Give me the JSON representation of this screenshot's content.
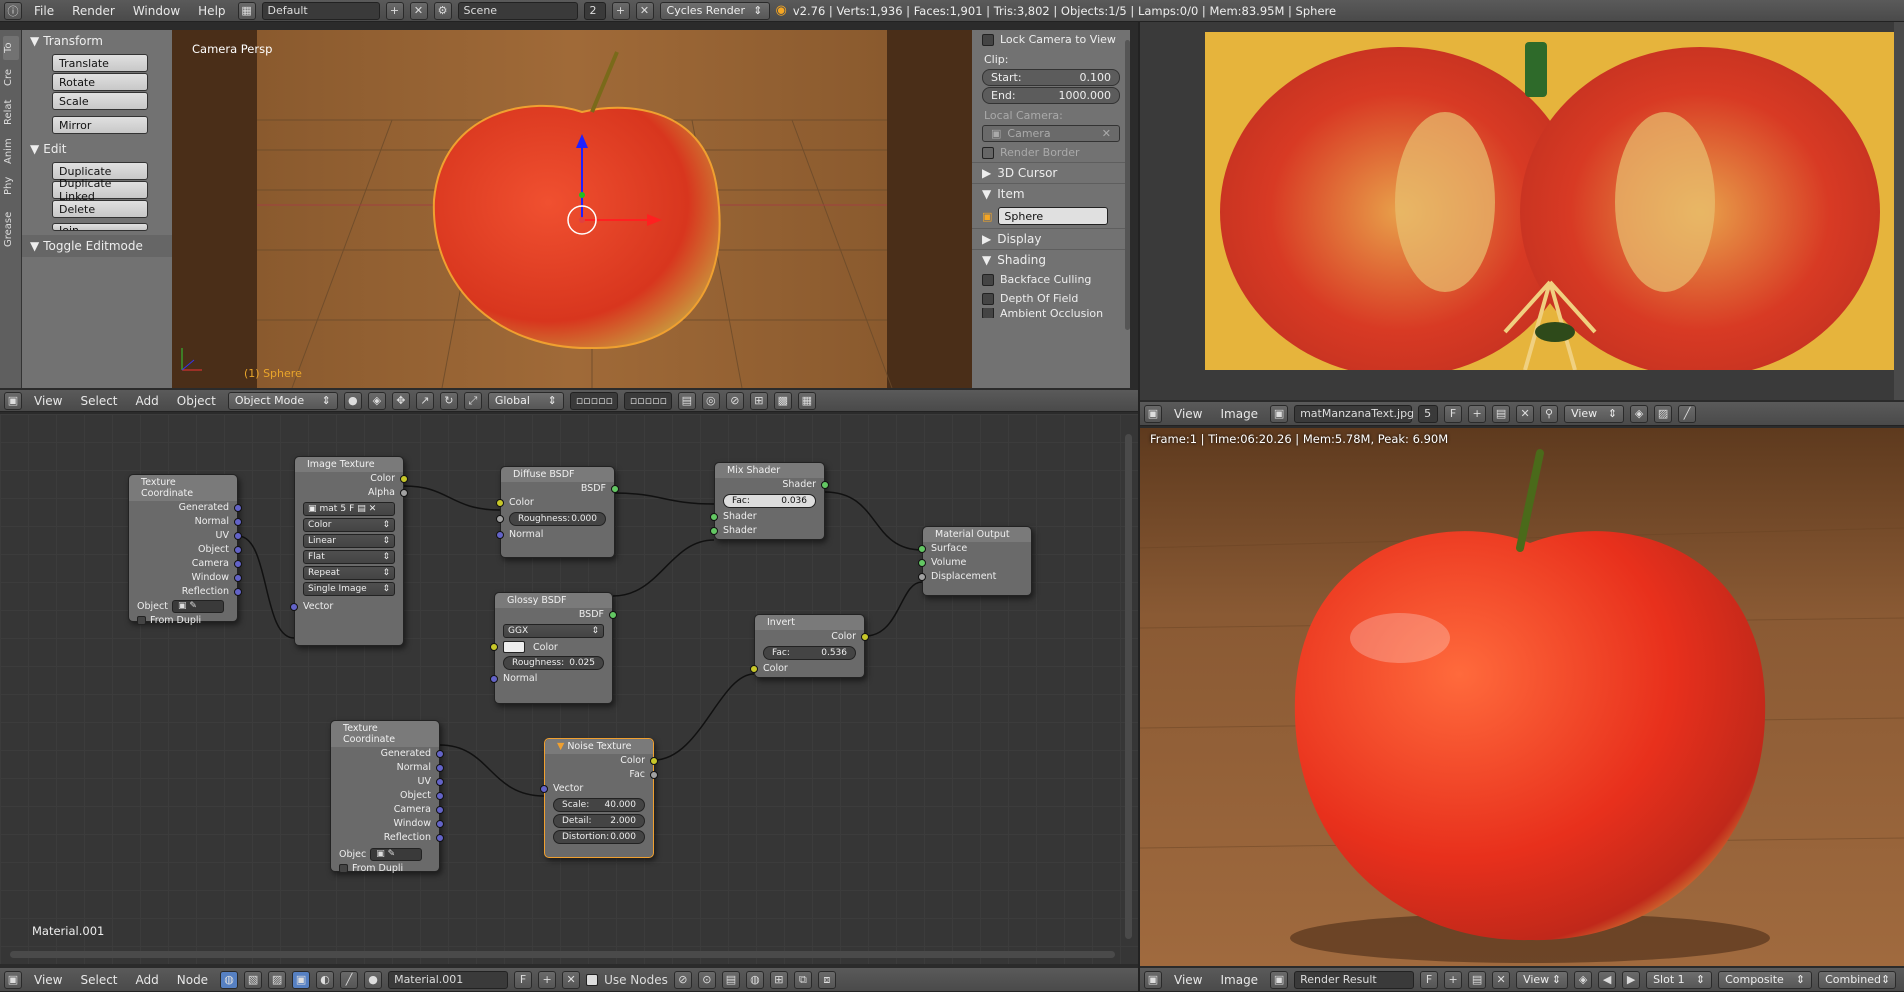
{
  "top_bar": {
    "menus": [
      "File",
      "Render",
      "Window",
      "Help"
    ],
    "layout": "Default",
    "scene": "Scene",
    "scene_users": "2",
    "engine": "Cycles Render",
    "stats": "v2.76 | Verts:1,936 | Faces:1,901 | Tris:3,802 | Objects:1/5 | Lamps:0/0 | Mem:83.95M | Sphere"
  },
  "tool_tabs": [
    "To",
    "Cre",
    "Relat",
    "Anim",
    "Phy",
    "Grease"
  ],
  "tool_panel": {
    "transform": "Transform",
    "translate": "Translate",
    "rotate": "Rotate",
    "scale": "Scale",
    "mirror": "Mirror",
    "edit": "Edit",
    "duplicate": "Duplicate",
    "duplicate_linked": "Duplicate Linked",
    "delete": "Delete",
    "join": "Join",
    "toggle_editmode": "Toggle Editmode"
  },
  "viewport": {
    "label": "Camera Persp",
    "object_label": "(1) Sphere"
  },
  "props_panel": {
    "lock_camera": "Lock Camera to View",
    "clip": "Clip:",
    "start_label": "Start:",
    "start_value": "0.100",
    "end_label": "End:",
    "end_value": "1000.000",
    "local_camera": "Local Camera:",
    "camera": "Camera",
    "render_border": "Render Border",
    "cursor3d": "3D Cursor",
    "item": "Item",
    "item_name": "Sphere",
    "display": "Display",
    "shading": "Shading",
    "backface": "Backface Culling",
    "dof": "Depth Of Field",
    "ao": "Ambient Occlusion"
  },
  "view3d_header": {
    "view": "View",
    "select": "Select",
    "add": "Add",
    "object": "Object",
    "mode": "Object Mode",
    "orientation": "Global"
  },
  "nodes": {
    "texcoord1": {
      "title": "Texture Coordinate",
      "outs": [
        "Generated",
        "Normal",
        "UV",
        "Object",
        "Camera",
        "Window",
        "Reflection"
      ],
      "object": "Object",
      "from_dupli": "From Dupli"
    },
    "image": {
      "title": "Image Texture",
      "outs": [
        "Color",
        "Alpha"
      ],
      "img": "mat",
      "users": "5",
      "f": "F",
      "color": "Color",
      "interp": "Linear",
      "proj": "Flat",
      "ext": "Repeat",
      "src": "Single Image",
      "vector": "Vector"
    },
    "diffuse": {
      "title": "Diffuse BSDF",
      "out": "BSDF",
      "color": "Color",
      "rough_label": "Roughness:",
      "rough": "0.000",
      "normal": "Normal"
    },
    "mix": {
      "title": "Mix Shader",
      "out": "Shader",
      "fac_label": "Fac:",
      "fac": "0.036",
      "s1": "Shader",
      "s2": "Shader"
    },
    "output": {
      "title": "Material Output",
      "surface": "Surface",
      "volume": "Volume",
      "displacement": "Displacement"
    },
    "glossy": {
      "title": "Glossy BSDF",
      "out": "BSDF",
      "dist": "GGX",
      "color": "Color",
      "rough_label": "Roughness:",
      "rough": "0.025",
      "normal": "Normal"
    },
    "invert": {
      "title": "Invert",
      "out": "Color",
      "fac_label": "Fac:",
      "fac": "0.536",
      "color": "Color"
    },
    "texcoord2": {
      "title": "Texture Coordinate",
      "outs": [
        "Generated",
        "Normal",
        "UV",
        "Object",
        "Camera",
        "Window",
        "Reflection"
      ],
      "object": "Objec",
      "from_dupli": "From Dupli"
    },
    "noise": {
      "title": "Noise Texture",
      "color": "Color",
      "fac": "Fac",
      "vector": "Vector",
      "scale_label": "Scale:",
      "scale": "40.000",
      "detail_label": "Detail:",
      "detail": "2.000",
      "dist_label": "Distortion:",
      "dist": "0.000"
    }
  },
  "node_editor": {
    "material_label": "Material.001"
  },
  "node_header": {
    "view": "View",
    "select": "Select",
    "add": "Add",
    "node": "Node",
    "material": "Material.001",
    "f": "F",
    "use_nodes": "Use Nodes"
  },
  "image_header_top": {
    "view": "View",
    "image": "Image",
    "img_name": "matManzanaText.jpg",
    "users": "5",
    "f": "F",
    "view_btn": "View"
  },
  "render_info": "Frame:1 | Time:06:20.26 | Mem:5.78M, Peak: 6.90M",
  "image_header_bottom": {
    "view": "View",
    "image": "Image",
    "img_name": "Render Result",
    "f": "F",
    "view_btn": "View",
    "slot": "Slot 1",
    "composite": "Composite",
    "combined": "Combined"
  }
}
